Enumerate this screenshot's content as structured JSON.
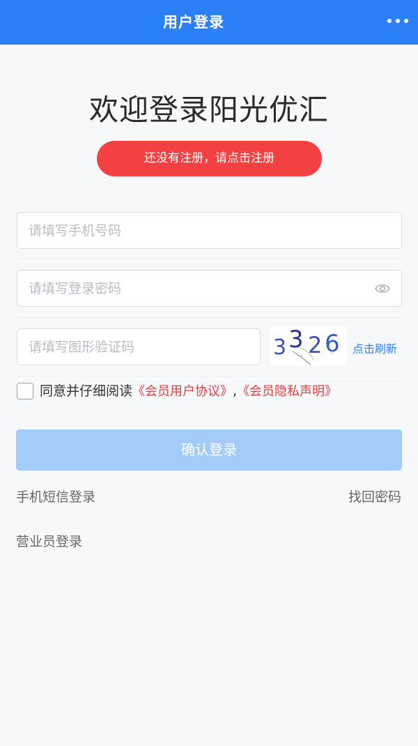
{
  "header": {
    "title": "用户登录",
    "more_icon": "more-dots-icon"
  },
  "welcome_title": "欢迎登录阳光优汇",
  "register_button": "还没有注册，请点击注册",
  "form": {
    "phone_placeholder": "请填写手机号码",
    "password_placeholder": "请填写登录密码",
    "password_toggle_icon": "eye-icon",
    "captcha_placeholder": "请填写图形验证码",
    "captcha_code": "3326",
    "refresh_label": "点击刷新"
  },
  "agreement": {
    "prefix": "同意并仔细阅读",
    "member_agreement": "《会员用户协议》",
    "separator": ",",
    "privacy_statement": "《会员隐私声明》",
    "checked": false
  },
  "confirm_button": "确认登录",
  "links": {
    "sms_login": "手机短信登录",
    "recover_password": "找回密码",
    "staff_login": "营业员登录"
  },
  "colors": {
    "primary": "#2b7ff7",
    "register_red": "#f34141",
    "confirm_disabled": "#a3ccf8",
    "agreement_link": "#e83a3a"
  }
}
